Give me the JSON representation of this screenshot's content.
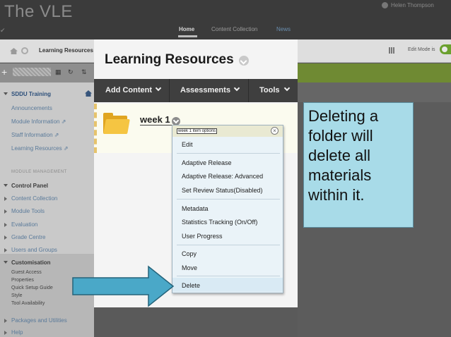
{
  "header": {
    "logo": "The VLE",
    "user_name": "Helen Thompson",
    "corner_glyph": "✔",
    "nav": {
      "home": "Home",
      "content_collection": "Content Collection",
      "news": "News"
    }
  },
  "breadcrumb": {
    "text": "Learning Resources",
    "edit_mode_label": "Edit Mode is"
  },
  "sidebar": {
    "course_title": "SDDU Training",
    "links": [
      "Announcements",
      "Module Information ⇗",
      "Staff Information ⇗",
      "Learning Resources ⇗"
    ],
    "module_management": "MODULE MANAGEMENT",
    "control_panel": "Control Panel",
    "control_items": [
      "Content Collection",
      "Module Tools",
      "Evaluation",
      "Grade Centre",
      "Users and Groups"
    ],
    "customisation": "Customisation",
    "customisation_items": [
      "Guest Access",
      "Properties",
      "Quick Setup Guide",
      "Style",
      "Tool Availability"
    ],
    "bottom_items": [
      "Packages and Utilities",
      "Help"
    ]
  },
  "main": {
    "title": "Learning Resources",
    "actions": [
      "Add Content",
      "Assessments",
      "Tools"
    ],
    "item_title": "week 1"
  },
  "context_menu": {
    "header_label": "week 1 item options",
    "close": "×",
    "items": [
      "Edit",
      "Adaptive Release",
      "Adaptive Release: Advanced",
      "Set Review Status(Disabled)",
      "Metadata",
      "Statistics Tracking (On/Off)",
      "User Progress",
      "Copy",
      "Move",
      "Delete"
    ]
  },
  "callout": {
    "text": "Deleting a folder will delete all materials within it."
  },
  "colors": {
    "topbar": "#3b3b3b",
    "green_bar": "#6f8a33",
    "callout": "#a8dbe8",
    "arrow": "#4aa8c8",
    "folder": "#f5c542"
  }
}
